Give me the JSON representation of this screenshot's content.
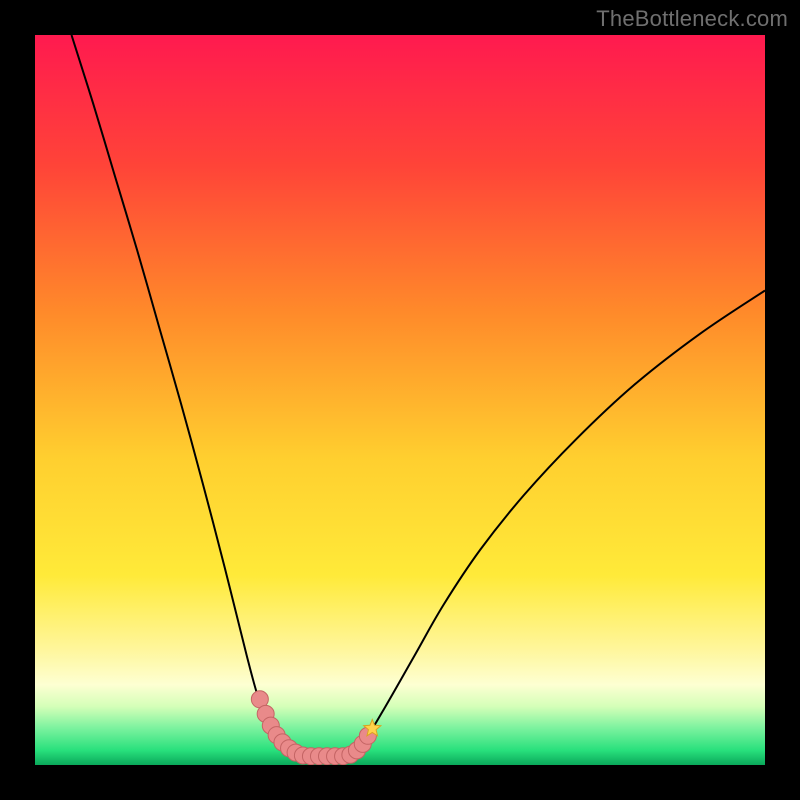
{
  "watermark": "TheBottleneck.com",
  "colors": {
    "frame": "#000000",
    "gradient_top": "#ff1a4f",
    "gradient_orange": "#ff8a2a",
    "gradient_yellow": "#ffea39",
    "gradient_pale": "#fdffd2",
    "gradient_green": "#28e07c",
    "gradient_dkgreen": "#0aa85a",
    "curve": "#000000",
    "marker_fill": "#e98a8a",
    "marker_stroke": "#c46464"
  },
  "chart_data": {
    "type": "line",
    "title": "",
    "xlabel": "",
    "ylabel": "",
    "xlim": [
      0,
      100
    ],
    "ylim": [
      0,
      100
    ],
    "series": [
      {
        "name": "left-curve",
        "x": [
          5,
          8,
          11,
          14,
          17,
          20,
          23,
          26,
          29,
          30.5,
          32,
          33.5,
          35,
          36.5
        ],
        "y": [
          100,
          90.5,
          80.5,
          70.5,
          60,
          49.5,
          38.5,
          27,
          15,
          9.5,
          5.5,
          3.5,
          2,
          1.2
        ]
      },
      {
        "name": "right-curve",
        "x": [
          43.5,
          45,
          48,
          52,
          56,
          61,
          67,
          74,
          82,
          91,
          100
        ],
        "y": [
          1.2,
          3,
          8,
          15,
          22,
          29.5,
          37,
          44.5,
          52,
          59,
          65
        ]
      },
      {
        "name": "floor",
        "x": [
          36.5,
          43.5
        ],
        "y": [
          1.2,
          1.2
        ]
      }
    ],
    "markers": {
      "name": "pink-markers",
      "points": [
        {
          "x": 30.8,
          "y": 9.0
        },
        {
          "x": 31.6,
          "y": 7.0
        },
        {
          "x": 32.3,
          "y": 5.4
        },
        {
          "x": 33.1,
          "y": 4.1
        },
        {
          "x": 33.9,
          "y": 3.1
        },
        {
          "x": 34.8,
          "y": 2.3
        },
        {
          "x": 35.7,
          "y": 1.7
        },
        {
          "x": 36.7,
          "y": 1.3
        },
        {
          "x": 37.8,
          "y": 1.2
        },
        {
          "x": 38.9,
          "y": 1.2
        },
        {
          "x": 40.0,
          "y": 1.2
        },
        {
          "x": 41.1,
          "y": 1.2
        },
        {
          "x": 42.2,
          "y": 1.2
        },
        {
          "x": 43.2,
          "y": 1.4
        },
        {
          "x": 44.1,
          "y": 2.0
        },
        {
          "x": 44.9,
          "y": 2.9
        },
        {
          "x": 45.6,
          "y": 4.0
        }
      ]
    },
    "star": {
      "x": 46.2,
      "y": 5.0
    }
  }
}
